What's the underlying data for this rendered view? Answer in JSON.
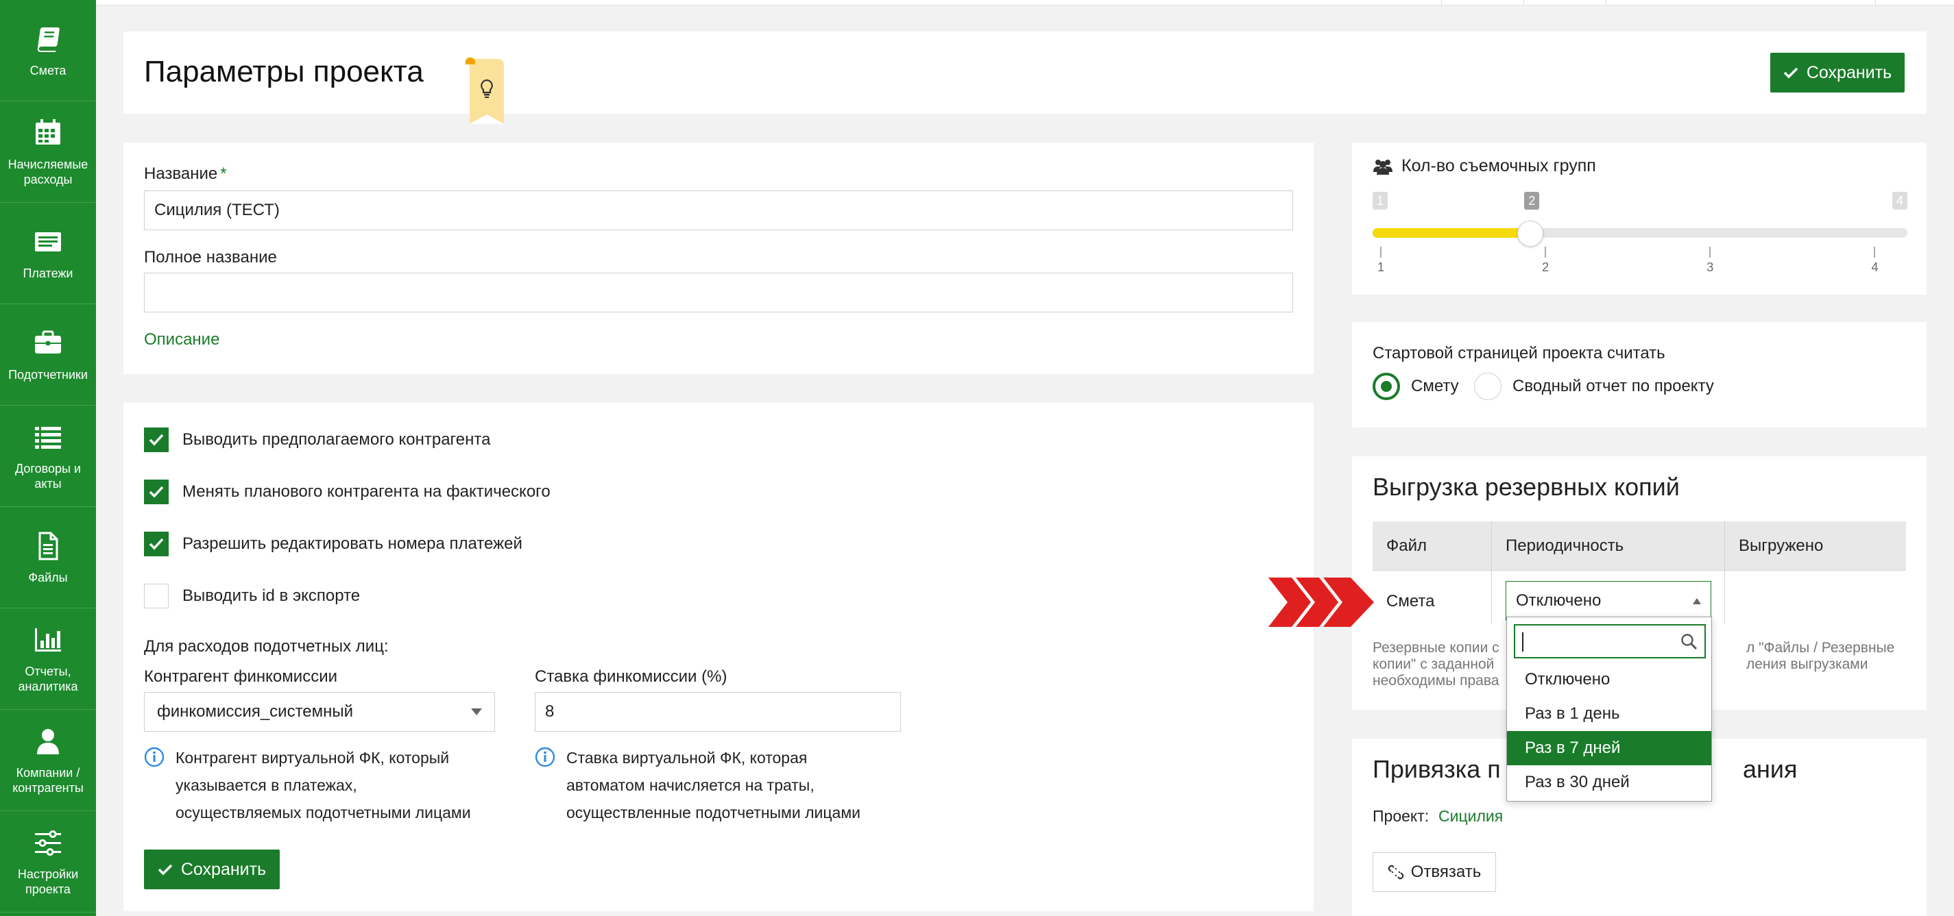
{
  "sidebar": {
    "items": [
      {
        "label": "Смета",
        "icon": "book-icon"
      },
      {
        "label": "Начисляемые расходы",
        "icon": "calendar-icon"
      },
      {
        "label": "Платежи",
        "icon": "payments-icon"
      },
      {
        "label": "Подотчетники",
        "icon": "briefcase-icon"
      },
      {
        "label": "Договоры и акты",
        "icon": "list-icon"
      },
      {
        "label": "Файлы",
        "icon": "file-icon"
      },
      {
        "label": "Отчеты, аналитика",
        "icon": "bar-chart-icon"
      },
      {
        "label": "Компании / контрагенты",
        "icon": "user-icon"
      },
      {
        "label": "Настройки проекта",
        "icon": "sliders-icon"
      }
    ]
  },
  "header": {
    "title": "Параметры проекта",
    "save_label": "Сохранить"
  },
  "project_form": {
    "name_label": "Название",
    "required_mark": "*",
    "name_value": "Сицилия (ТЕСТ)",
    "full_name_label": "Полное название",
    "full_name_value": "",
    "description_link": "Описание"
  },
  "options": {
    "checkboxes": [
      {
        "label": "Выводить предполагаемого контрагента",
        "checked": true
      },
      {
        "label": "Менять планового контрагента на фактического",
        "checked": true
      },
      {
        "label": "Разрешить редактировать номера платежей",
        "checked": true
      },
      {
        "label": "Выводить id в экспорте",
        "checked": false
      }
    ],
    "accountable_label": "Для расходов подотчетных лиц:",
    "counterparty_label": "Контрагент финкомиссии",
    "counterparty_value": "финкомиссия_системный",
    "rate_label": "Ставка финкомиссии (%)",
    "rate_value": "8",
    "counterparty_info": [
      "Контрагент виртуальной ФК, который",
      "указывается в платежах,",
      "осуществляемых подотчетными лицами"
    ],
    "rate_info": [
      "Ставка виртуальной ФК, которая",
      "автоматом начисляется на траты,",
      "осуществленные подотчетными лицами"
    ],
    "save_label": "Сохранить"
  },
  "crews": {
    "title": "Кол-во съемочных групп",
    "min": 1,
    "max": 4,
    "value": 2,
    "min_label": "1",
    "max_label": "4",
    "value_label": "2",
    "scale": [
      "1",
      "2",
      "3",
      "4"
    ],
    "fill_color": "#f5d90a"
  },
  "start_page": {
    "title": "Стартовой страницей проекта считать",
    "options": [
      {
        "label": "Смету",
        "selected": true
      },
      {
        "label": "Сводный отчет по проекту",
        "selected": false
      }
    ]
  },
  "backup": {
    "title": "Выгрузка резервных копий",
    "columns": [
      "Файл",
      "Периодичность",
      "Выгружено"
    ],
    "row": {
      "file": "Смета",
      "periodicity": "Отключено",
      "uploaded": ""
    },
    "note_lines": [
      "Резервные копии с",
      "л \"Файлы / Резервные",
      "копии\" с заданной",
      "ления выгрузками",
      "необходимы права"
    ],
    "dropdown": {
      "search_value": "",
      "options": [
        "Отключено",
        "Раз в 1 день",
        "Раз в 7 дней",
        "Раз в 30 дней"
      ],
      "selected_index": 2
    }
  },
  "binding": {
    "title_left": "Привязка п",
    "title_right": "ания",
    "project_label": "Проект:",
    "project_value": "Сицилия",
    "unbind_label": "Отвязать"
  },
  "colors": {
    "brand_green": "#1d8a2e",
    "accent_green": "#1a7c2a",
    "arrow_red": "#e02020"
  }
}
